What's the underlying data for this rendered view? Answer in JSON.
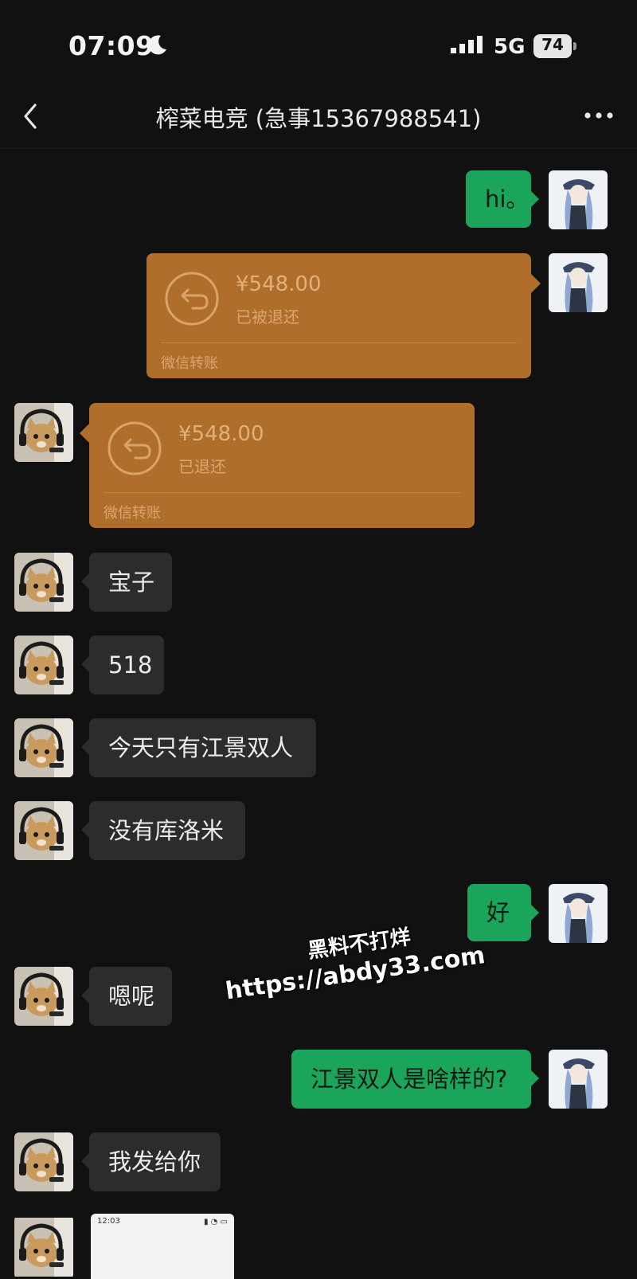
{
  "status_bar": {
    "time": "07:09",
    "network": "5G",
    "battery": "74"
  },
  "nav": {
    "title": "榨菜电竞 (急事15367988541)",
    "back_icon": "chevron-left-icon",
    "more_icon": "more-dots-icon"
  },
  "messages": [
    {
      "side": "out",
      "type": "text",
      "text": "hi。"
    },
    {
      "side": "out",
      "type": "transfer",
      "amount": "¥548.00",
      "status": "已被退还",
      "label": "微信转账"
    },
    {
      "side": "in",
      "type": "transfer",
      "amount": "¥548.00",
      "status": "已退还",
      "label": "微信转账"
    },
    {
      "side": "in",
      "type": "text",
      "text": "宝子"
    },
    {
      "side": "in",
      "type": "text",
      "text": "518"
    },
    {
      "side": "in",
      "type": "text",
      "text": "今天只有江景双人"
    },
    {
      "side": "in",
      "type": "text",
      "text": "没有库洛米"
    },
    {
      "side": "out",
      "type": "text",
      "text": "好"
    },
    {
      "side": "in",
      "type": "text",
      "text": "嗯呢"
    },
    {
      "side": "out",
      "type": "text",
      "text": "江景双人是啥样的?"
    },
    {
      "side": "in",
      "type": "text",
      "text": "我发给你"
    },
    {
      "side": "in",
      "type": "image",
      "preview_time": "12:03"
    }
  ],
  "watermark": {
    "line1": "黑料不打烊",
    "line2": "https://abdy33.com"
  },
  "colors": {
    "background": "#111111",
    "out_bubble": "#1aa55a",
    "in_bubble": "#2c2c2c",
    "transfer_card": "#b06e2c"
  }
}
